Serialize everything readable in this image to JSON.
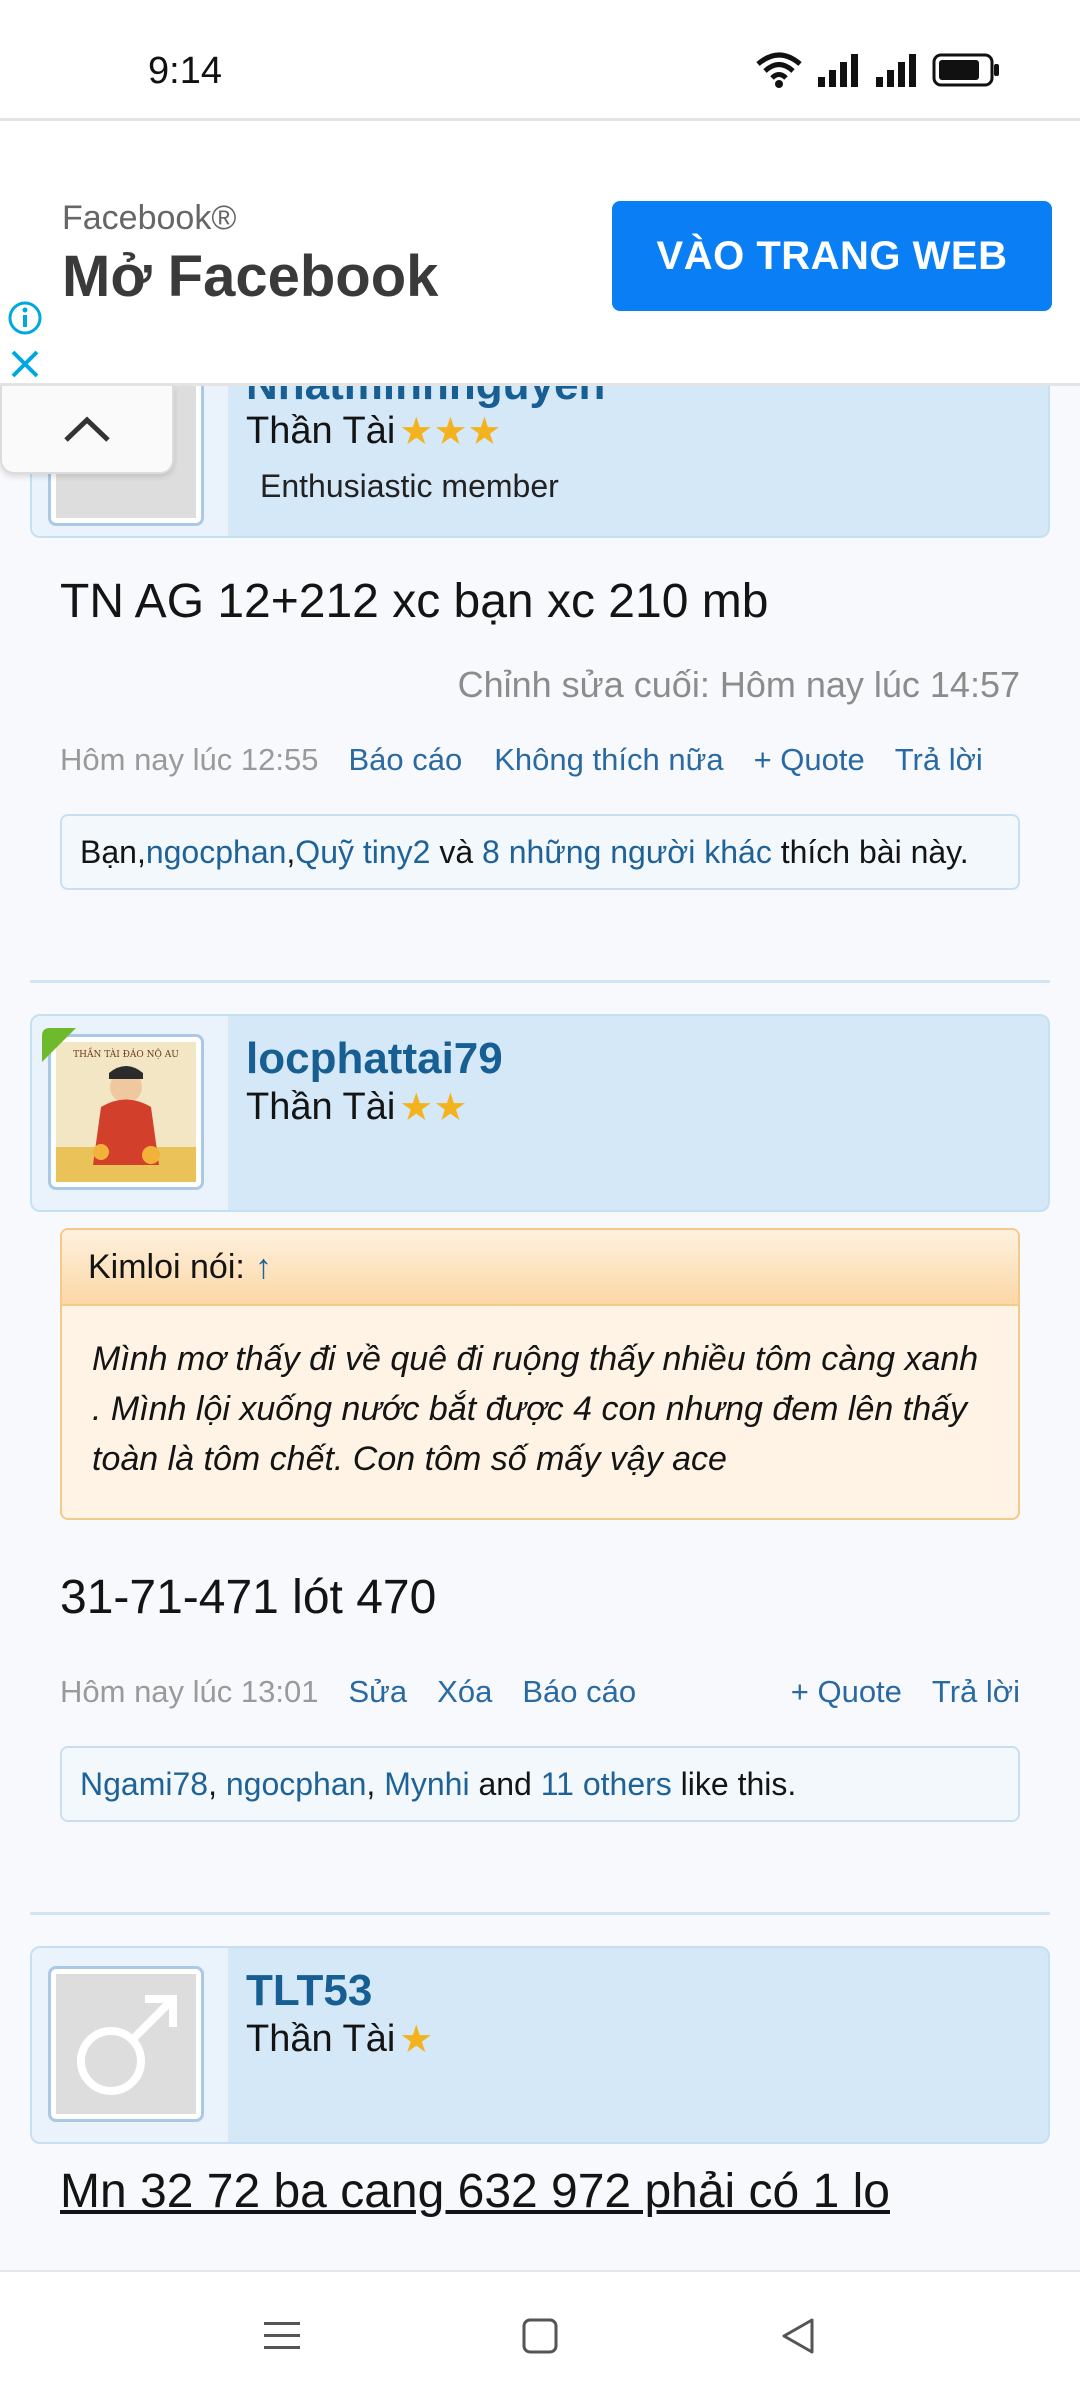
{
  "status": {
    "time": "9:14"
  },
  "ad": {
    "brand": "Facebook®",
    "title": "Mở Facebook",
    "cta": "VÀO TRANG WEB"
  },
  "post1": {
    "username_partial": "Nhatminhnguyen",
    "rank": "Thần Tài",
    "stars": 3,
    "member_title": "Enthusiastic member",
    "message": "TN AG 12+212 xc bạn xc 210 mb",
    "edited": "Chỉnh sửa cuối: Hôm nay lúc 14:57",
    "time": "Hôm nay lúc 12:55",
    "actions": {
      "report": "Báo cáo",
      "unlike": "Không thích nữa",
      "quote": "+ Quote",
      "reply": "Trả lời"
    },
    "likes": {
      "prefix": "Bạn, ",
      "user1": "ngocphan",
      "sep1": ", ",
      "user2": "Quỹ tiny2",
      "mid": " và ",
      "others": "8 những người khác",
      "suffix": " thích bài này."
    }
  },
  "post2": {
    "username": "locphattai79",
    "rank": "Thần Tài",
    "stars": 2,
    "avatar_caption": "THẦN TÀI ĐÁO NỘ AU",
    "quote_author": "Kimloi nói:",
    "quote_arrow": "↑",
    "quote_text": "Mình mơ thấy đi về quê đi ruộng thấy nhiều tôm càng xanh . Mình lội xuống nước bắt được 4 con nhưng đem lên thấy toàn là tôm chết. Con tôm số mấy vậy ace",
    "message": "31-71-471 lót 470",
    "time": "Hôm nay lúc 13:01",
    "actions": {
      "edit": "Sửa",
      "delete": "Xóa",
      "report": "Báo cáo",
      "quote": "+ Quote",
      "reply": "Trả lời"
    },
    "likes": {
      "user1": "Ngami78",
      "sep1": ", ",
      "user2": "ngocphan",
      "sep2": ", ",
      "user3": "Mynhi",
      "mid": " and ",
      "others": "11 others",
      "suffix": " like this."
    }
  },
  "post3": {
    "username": "TLT53",
    "rank": "Thần Tài",
    "stars": 1,
    "message": "Mn 32 72 ba cang 632 972 phải có 1 lo"
  },
  "colors": {
    "link": "#1f6298",
    "username": "#175e92",
    "ad_button": "#0a7ff5",
    "star": "#f3b31f"
  }
}
